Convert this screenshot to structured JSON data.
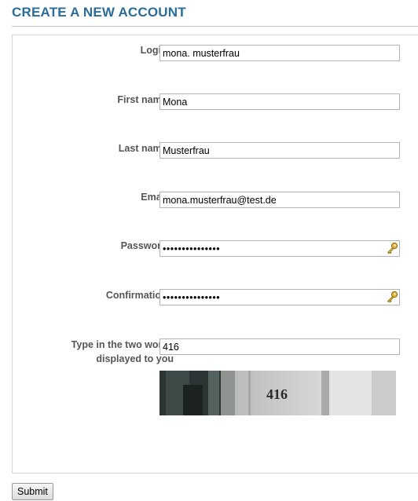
{
  "page": {
    "title": "CREATE A NEW ACCOUNT"
  },
  "required_marker": "*",
  "form": {
    "login": {
      "label": "Login",
      "value": "mona. musterfrau"
    },
    "first_name": {
      "label": "First name",
      "value": "Mona"
    },
    "last_name": {
      "label": "Last name",
      "value": "Musterfrau"
    },
    "email": {
      "label": "Email",
      "value": "mona.musterfrau@test.de"
    },
    "password": {
      "label": "Password",
      "value": "•••••••••••••••"
    },
    "confirmation": {
      "label": "Confirmation",
      "value": "•••••••••••••••"
    },
    "captcha": {
      "label_line1": "Type in the two words",
      "label_line2": "displayed to you",
      "value": "416",
      "image_text": "416"
    }
  },
  "buttons": {
    "submit": "Submit"
  },
  "icons": {
    "password_reveal": "key-icon"
  },
  "colors": {
    "accent": "#2a6c9a"
  }
}
